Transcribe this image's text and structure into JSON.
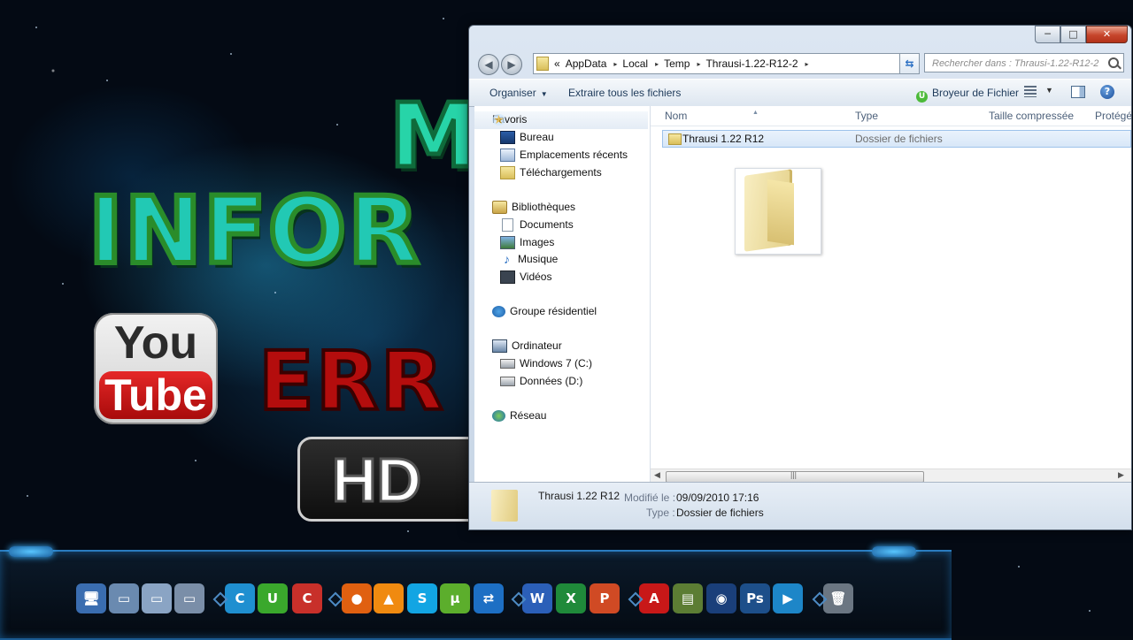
{
  "wallpaper": {
    "text_m": "M",
    "text_infor": "INFOR",
    "text_err": "ERR",
    "youtube_you": "You",
    "youtube_tube": "Tube",
    "hd": "HD"
  },
  "window": {
    "caption_buttons": {
      "minimize": "─",
      "maximize": "□",
      "close": "✕"
    },
    "nav": {
      "back": "◀",
      "forward": "▶"
    },
    "address": {
      "prefix": "«",
      "crumbs": [
        "AppData",
        "Local",
        "Temp",
        "Thrausi-1.22-R12-2"
      ],
      "separator": "▸"
    },
    "search_placeholder": "Rechercher dans : Thrausi-1.22-R12-2",
    "toolbar": {
      "organize": "Organiser",
      "extract_all": "Extraire tous les fichiers",
      "u_badge": "U",
      "broyeur": "Broyeur de Fichier",
      "help": "?"
    },
    "navpane": {
      "favorites": "Favoris",
      "bureau": "Bureau",
      "recent": "Emplacements récents",
      "downloads": "Téléchargements",
      "libraries": "Bibliothèques",
      "documents": "Documents",
      "images": "Images",
      "music": "Musique",
      "videos": "Vidéos",
      "homegroup": "Groupe résidentiel",
      "computer": "Ordinateur",
      "drive_c": "Windows 7 (C:)",
      "drive_d": "Données (D:)",
      "network": "Réseau"
    },
    "columns": {
      "name": "Nom",
      "type": "Type",
      "compressed_size": "Taille compressée",
      "protected": "Protégé"
    },
    "files": [
      {
        "name": "Thrausi 1.22 R12",
        "type": "Dossier de fichiers"
      }
    ],
    "details": {
      "name": "Thrausi 1.22 R12",
      "modified_label": "Modifié le :",
      "modified_value": "09/09/2010 17:16",
      "type_label": "Type :",
      "type_value": "Dossier de fichiers"
    }
  },
  "dock": {
    "icons": [
      {
        "name": "computer",
        "glyph": "🖥",
        "color": "#3a6db0"
      },
      {
        "name": "folder-open",
        "glyph": "▭",
        "color": "#6a8ab0"
      },
      {
        "name": "folder",
        "glyph": "▭",
        "color": "#8aa4c4"
      },
      {
        "name": "folder-tools",
        "glyph": "▭",
        "color": "#7a8ea8"
      },
      {
        "name": "ccleaner",
        "glyph": "C",
        "color": "#1f8fd0"
      },
      {
        "name": "uniblue",
        "glyph": "U",
        "color": "#3aa82c"
      },
      {
        "name": "ccleaner-red",
        "glyph": "C",
        "color": "#c8302a"
      },
      {
        "name": "firefox",
        "glyph": "●",
        "color": "#e06010"
      },
      {
        "name": "vlc",
        "glyph": "▲",
        "color": "#f08a10"
      },
      {
        "name": "skype",
        "glyph": "S",
        "color": "#12a5e3"
      },
      {
        "name": "utorrent",
        "glyph": "µ",
        "color": "#5cae2c"
      },
      {
        "name": "teamviewer",
        "glyph": "⇄",
        "color": "#1d6fc4"
      },
      {
        "name": "word",
        "glyph": "W",
        "color": "#2b5fb8"
      },
      {
        "name": "excel",
        "glyph": "X",
        "color": "#1f8a3a"
      },
      {
        "name": "powerpoint",
        "glyph": "P",
        "color": "#d04a24"
      },
      {
        "name": "avira",
        "glyph": "A",
        "color": "#c81818"
      },
      {
        "name": "archive",
        "glyph": "▤",
        "color": "#5c7d34"
      },
      {
        "name": "cinema4d",
        "glyph": "◉",
        "color": "#1a3f7a"
      },
      {
        "name": "photoshop",
        "glyph": "Ps",
        "color": "#1d4f8a"
      },
      {
        "name": "media-player",
        "glyph": "▶",
        "color": "#1d86c8"
      },
      {
        "name": "recycle-bin",
        "glyph": "🗑",
        "color": "#6b7682"
      }
    ]
  }
}
